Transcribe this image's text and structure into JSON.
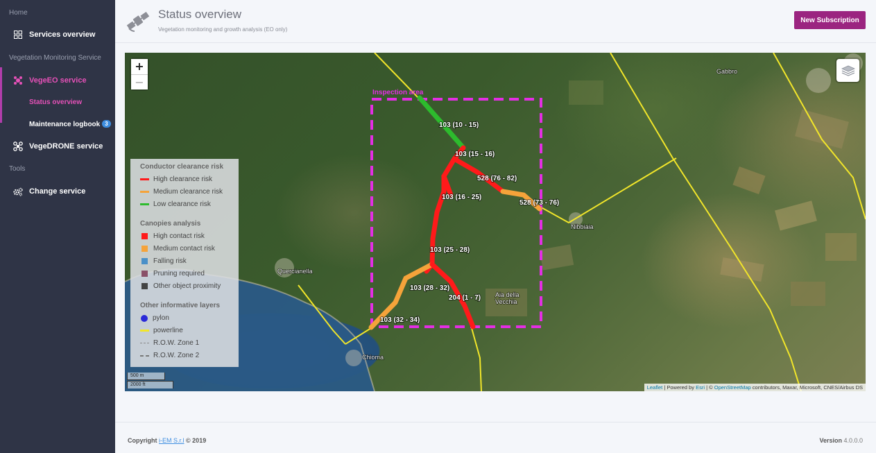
{
  "sidebar": {
    "home_header": "Home",
    "services_overview": "Services overview",
    "vegetation_header": "Vegetation Monitoring Service",
    "vegeeo_service": "VegeEO service",
    "status_overview": "Status overview",
    "maintenance_logbook": "Maintenance logbook",
    "maintenance_badge": "3",
    "vegedrone_service": "VegeDRONE service",
    "tools_header": "Tools",
    "change_service": "Change service",
    "active_color": "#e651b8"
  },
  "header": {
    "title": "Status overview",
    "subtitle": "Vegetation monitoring and growth analysis (EO only)",
    "new_subscription": "New Subscription",
    "button_color": "#9b2480"
  },
  "map": {
    "zoom_in": "+",
    "zoom_out": "−",
    "inspection_area_label": "Inspection area",
    "segments": [
      {
        "label": "103 (10 - 15)",
        "risk": "low"
      },
      {
        "label": "103 (15 - 16)",
        "risk": "high"
      },
      {
        "label": "528 (76 - 82)",
        "risk": "high"
      },
      {
        "label": "528 (73 - 76)",
        "risk": "medium"
      },
      {
        "label": "103 (16 - 25)",
        "risk": "high"
      },
      {
        "label": "103 (25 - 28)",
        "risk": "high"
      },
      {
        "label": "103 (28 - 32)",
        "risk": "medium"
      },
      {
        "label": "204 (1 - 7)",
        "risk": "high"
      },
      {
        "label": "103 (32 - 34)",
        "risk": "medium"
      }
    ],
    "places": [
      "Gabbro",
      "Nibbiaia",
      "Quercianella",
      "Aia della",
      "Vecchia",
      "Chioma"
    ],
    "scale_m": "500 m",
    "scale_ft": "2000 ft",
    "attribution": {
      "leaflet": "Leaflet",
      "powered_by": "| Powered by",
      "esri": "Esri",
      "copyright_sep": "| ©",
      "osm": "OpenStreetMap",
      "rest": "contributors, Maxar, Microsoft, CNES/Airbus DS"
    },
    "colors": {
      "high": "#ff1a1a",
      "medium": "#f5a33a",
      "low": "#2dbb2d",
      "powerline": "#f2e62a",
      "inspection": "#e32ee3"
    }
  },
  "legend": {
    "conductor_title": "Conductor clearance risk",
    "high_clearance": "High clearance risk",
    "medium_clearance": "Medium clearance risk",
    "low_clearance": "Low clearance risk",
    "canopies_title": "Canopies analysis",
    "high_contact": "High contact risk",
    "medium_contact": "Medium contact risk",
    "falling": "Falling risk",
    "pruning": "Pruning required",
    "other_proximity": "Other object proximity",
    "other_layers_title": "Other informative layers",
    "pylon": "pylon",
    "powerline": "powerline",
    "row_zone1": "R.O.W. Zone 1",
    "row_zone2": "R.O.W. Zone 2",
    "colors": {
      "high": "#ff1a1a",
      "medium": "#f5a33a",
      "low": "#2dbb2d",
      "falling": "#4a90c8",
      "pruning": "#8a5068",
      "proximity": "#444444",
      "pylon": "#2a2ad8",
      "powerline": "#f2e62a"
    }
  },
  "footer": {
    "copyright_prefix": "Copyright",
    "company": "i-EM S.r.l",
    "copyright_suffix": "© 2019",
    "version_label": "Version",
    "version_number": "4.0.0.0"
  }
}
